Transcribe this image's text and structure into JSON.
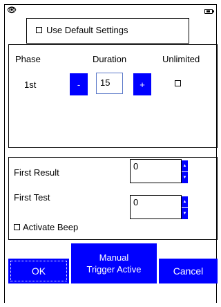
{
  "status": {
    "left_icon": "binoculars-icon",
    "right_icon": "battery-icon"
  },
  "settings": {
    "use_default_label": "Use Default Settings"
  },
  "phase_table": {
    "headers": {
      "phase": "Phase",
      "duration": "Duration",
      "unlimited": "Unlimited"
    },
    "rows": [
      {
        "phase": "1st",
        "minus_label": "-",
        "duration_value": "15",
        "plus_label": "+"
      }
    ]
  },
  "results": {
    "first_result_label": "First Result",
    "first_result_value": "0",
    "first_test_label": "First Test",
    "first_test_value": "0",
    "activate_beep_label": "Activate Beep"
  },
  "buttons": {
    "ok": "OK",
    "trigger_line1": "Manual",
    "trigger_line2": "Trigger Active",
    "cancel": "Cancel"
  },
  "colors": {
    "accent": "#0000ff"
  }
}
